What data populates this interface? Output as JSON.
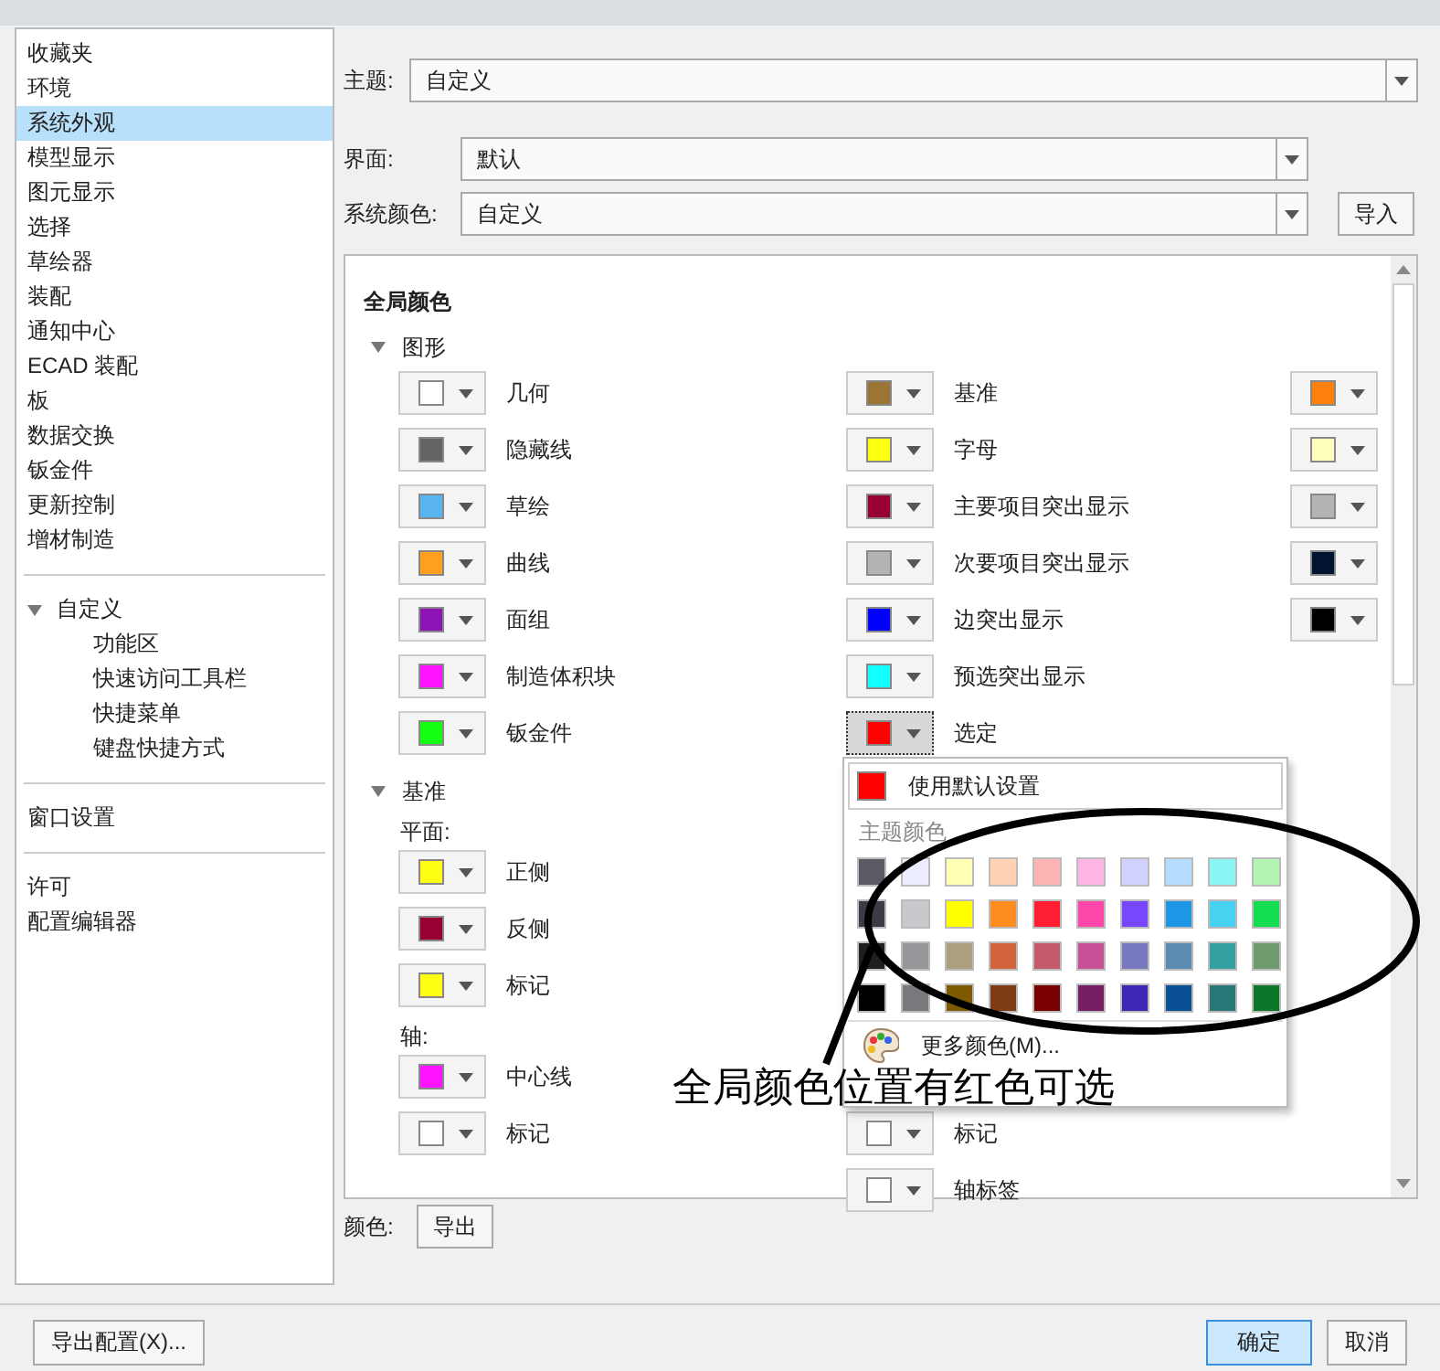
{
  "sidebar": {
    "sections": [
      {
        "items": [
          {
            "label": "收藏夹",
            "selected": false
          },
          {
            "label": "环境",
            "selected": false
          },
          {
            "label": "系统外观",
            "selected": true
          },
          {
            "label": "模型显示",
            "selected": false
          },
          {
            "label": "图元显示",
            "selected": false
          },
          {
            "label": "选择",
            "selected": false
          },
          {
            "label": "草绘器",
            "selected": false
          },
          {
            "label": "装配",
            "selected": false
          },
          {
            "label": "通知中心",
            "selected": false
          },
          {
            "label": "ECAD 装配",
            "selected": false
          },
          {
            "label": "板",
            "selected": false
          },
          {
            "label": "数据交换",
            "selected": false
          },
          {
            "label": "钣金件",
            "selected": false
          },
          {
            "label": "更新控制",
            "selected": false
          },
          {
            "label": "增材制造",
            "selected": false
          }
        ]
      },
      {
        "items": [
          {
            "label": "自定义",
            "selected": false,
            "expanded": true,
            "children": [
              {
                "label": "功能区",
                "selected": false
              },
              {
                "label": "快速访问工具栏",
                "selected": false
              },
              {
                "label": "快捷菜单",
                "selected": false
              },
              {
                "label": "键盘快捷方式",
                "selected": false
              }
            ]
          }
        ]
      },
      {
        "items": [
          {
            "label": "窗口设置",
            "selected": false
          }
        ]
      },
      {
        "items": [
          {
            "label": "许可",
            "selected": false
          },
          {
            "label": "配置编辑器",
            "selected": false
          }
        ]
      }
    ]
  },
  "theme": {
    "label": "主题:",
    "value": "自定义"
  },
  "interface": {
    "label": "界面:",
    "value": "默认"
  },
  "system_color": {
    "label": "系统颜色:",
    "value": "自定义",
    "button": "导入"
  },
  "global_colors": {
    "title": "全局颜色",
    "groups": [
      {
        "label": "图形",
        "expanded": true,
        "sections": [
          {
            "rows": [
              {
                "left": {
                  "color": "#ffffff",
                  "label": "几何",
                  "open": false
                },
                "middle": {
                  "color": "#9c7434",
                  "label": "基准",
                  "open": false
                },
                "right": {
                  "color": "#ff7f0f",
                  "open": false
                }
              },
              {
                "left": {
                  "color": "#646464",
                  "label": "隐藏线",
                  "open": false
                },
                "middle": {
                  "color": "#ffff14",
                  "label": "字母",
                  "open": false
                },
                "right": {
                  "color": "#ffffbe",
                  "open": false
                }
              },
              {
                "left": {
                  "color": "#5ab4f0",
                  "label": "草绘",
                  "open": false
                },
                "middle": {
                  "color": "#960032",
                  "label": "主要项目突出显示",
                  "open": false
                },
                "right": {
                  "color": "#b4b4b4",
                  "open": false
                }
              },
              {
                "left": {
                  "color": "#ffa01e",
                  "label": "曲线",
                  "open": false
                },
                "middle": {
                  "color": "#b4b4b4",
                  "label": "次要项目突出显示",
                  "open": false
                },
                "right": {
                  "color": "#001432",
                  "open": false
                }
              },
              {
                "left": {
                  "color": "#8c14b4",
                  "label": "面组",
                  "open": false
                },
                "middle": {
                  "color": "#0000ff",
                  "label": "边突出显示",
                  "open": false
                },
                "right": {
                  "color": "#000000",
                  "open": false
                }
              },
              {
                "left": {
                  "color": "#ff14ff",
                  "label": "制造体积块",
                  "open": false
                },
                "middle": {
                  "color": "#14ffff",
                  "label": "预选突出显示",
                  "open": false
                }
              },
              {
                "left": {
                  "color": "#14ff14",
                  "label": "钣金件",
                  "open": false
                },
                "middle": {
                  "color": "#ff0000",
                  "label": "选定",
                  "open": true
                }
              }
            ]
          }
        ]
      },
      {
        "label": "基准",
        "expanded": true,
        "sections": [
          {
            "heading": "平面:",
            "rows": [
              {
                "left": {
                  "color": "#ffff14",
                  "label": "正侧",
                  "open": false
                }
              },
              {
                "left": {
                  "color": "#960032",
                  "label": "反侧",
                  "open": false
                }
              },
              {
                "left": {
                  "color": "#ffff14",
                  "label": "标记",
                  "open": false
                }
              }
            ]
          },
          {
            "heading": "轴:",
            "rows": [
              {
                "left": {
                  "color": "#ff14ff",
                  "label": "中心线",
                  "open": false
                }
              },
              {
                "left": {
                  "color": "#ffffff",
                  "label": "标记",
                  "open": false
                },
                "middle": {
                  "color": "#ffffff",
                  "label": "标记",
                  "open": false
                }
              },
              {
                "middle": {
                  "color": "#ffffff",
                  "label": "轴标签",
                  "open": false
                }
              }
            ]
          }
        ]
      }
    ],
    "color_menu": {
      "default_option": {
        "label": "使用默认设置",
        "color": "#ff0000"
      },
      "theme_heading": "主题颜色",
      "more_label": "更多颜色(M)...",
      "theme_colors": [
        [
          {
            "color": "#5a5a64"
          },
          {
            "color": "#ececff"
          },
          {
            "color": "#ffffb4"
          },
          {
            "color": "#ffd2b4"
          },
          {
            "color": "#ffb4b4"
          },
          {
            "color": "#ffb4e6"
          },
          {
            "color": "#d2d2ff"
          },
          {
            "color": "#b4dcff"
          },
          {
            "color": "#8cf5f5"
          },
          {
            "color": "#b4f5b4"
          }
        ],
        [
          {
            "color": "#3c3c46"
          },
          {
            "color": "#c8c8cd"
          },
          {
            "color": "#ffff00"
          },
          {
            "color": "#ff8c1e"
          },
          {
            "color": "#ff1e32"
          },
          {
            "color": "#ff46aa"
          },
          {
            "color": "#7846ff"
          },
          {
            "color": "#1e96e6"
          },
          {
            "color": "#46d2f0"
          },
          {
            "color": "#14dc50"
          }
        ],
        [
          {
            "color": "#1e1e23"
          },
          {
            "color": "#96969b"
          },
          {
            "color": "#aaa07d"
          },
          {
            "color": "#d2643c"
          },
          {
            "color": "#c35a69"
          },
          {
            "color": "#c85096"
          },
          {
            "color": "#7878be"
          },
          {
            "color": "#5a8cb4"
          },
          {
            "color": "#32a0a0"
          },
          {
            "color": "#6e9b6e"
          }
        ],
        [
          {
            "color": "#000000"
          },
          {
            "color": "#78787d"
          },
          {
            "color": "#7d5a00"
          },
          {
            "color": "#7d3c14"
          },
          {
            "color": "#780000"
          },
          {
            "color": "#781e64"
          },
          {
            "color": "#3c28b4"
          },
          {
            "color": "#0a5096"
          },
          {
            "color": "#287878"
          },
          {
            "color": "#0a7828"
          }
        ]
      ]
    }
  },
  "colors_row": {
    "label": "颜色:",
    "button": "导出"
  },
  "footer": {
    "export_button": "导出配置(X)...",
    "ok_button": "确定",
    "cancel_button": "取消"
  },
  "annotation": {
    "text": "全局颜色位置有红色可选"
  }
}
